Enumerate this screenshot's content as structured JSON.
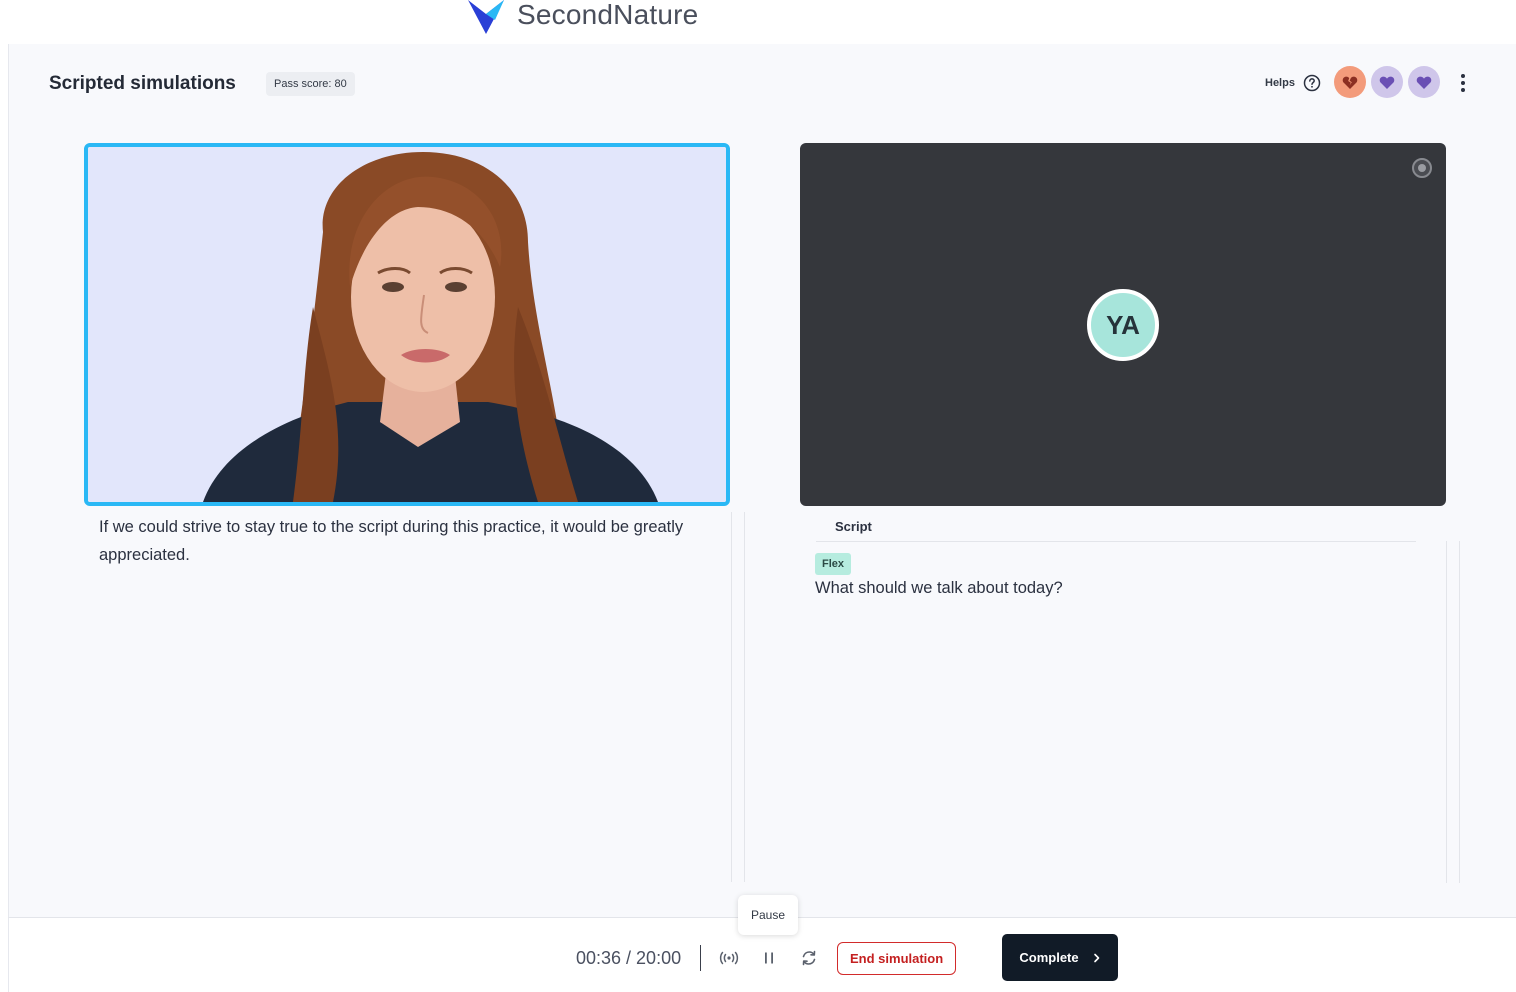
{
  "brand": {
    "name": "SecondNature"
  },
  "header": {
    "title": "Scripted simulations",
    "pass_label": "Pass score:",
    "pass_value": "80",
    "helps_label": "Helps",
    "hearts": [
      "broken",
      "full",
      "full"
    ]
  },
  "avatar": {
    "message": "If we could strive to stay true to the script during this practice, it would be greatly appreciated."
  },
  "user": {
    "initials": "YA"
  },
  "script": {
    "label": "Script",
    "tag": "Flex",
    "line": "What should we talk about today?"
  },
  "controls": {
    "timer": "00:36 / 20:00",
    "tooltip": "Pause",
    "end_label": "End simulation",
    "complete_label": "Complete"
  },
  "colors": {
    "accent_border": "#2ab8f5",
    "end_red": "#c42020",
    "complete_bg": "#111b27",
    "flex_tag": "#b6ecdf",
    "avatar_circle": "#a7e5db"
  }
}
